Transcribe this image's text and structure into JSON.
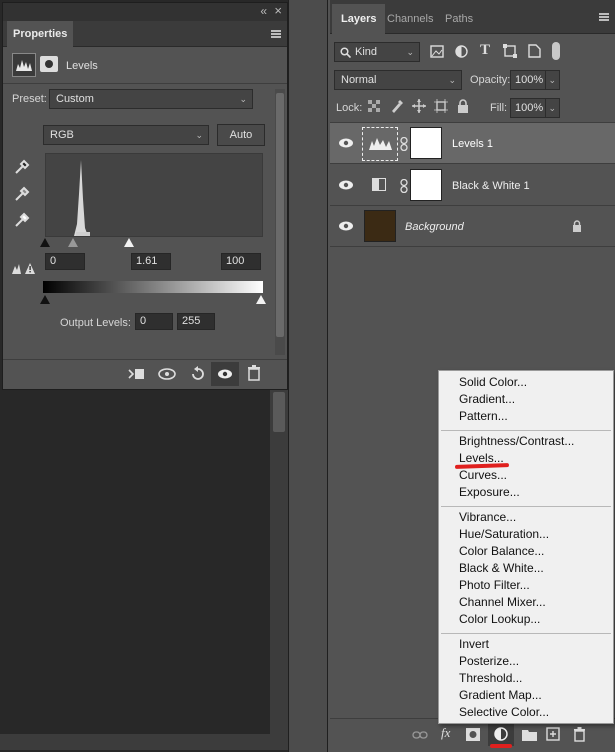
{
  "properties": {
    "title": "Properties",
    "collapse_glyph": "«",
    "close_glyph": "×",
    "adjustment_name": "Levels",
    "preset_label": "Preset:",
    "preset_value": "Custom",
    "channel_value": "RGB",
    "auto_label": "Auto",
    "input_black": "0",
    "input_gamma": "1.61",
    "input_white": "100",
    "output_label": "Output Levels:",
    "output_black": "0",
    "output_white": "255"
  },
  "layers_panel": {
    "tabs": [
      "Layers",
      "Channels",
      "Paths"
    ],
    "filter_kind": "Kind",
    "blend_mode": "Normal",
    "opacity_label": "Opacity:",
    "opacity_value": "100%",
    "lock_label": "Lock:",
    "fill_label": "Fill:",
    "fill_value": "100%",
    "layers": [
      {
        "name": "Levels 1"
      },
      {
        "name": "Black & White 1"
      },
      {
        "name": "Background"
      }
    ],
    "bottom_fx": "fx"
  },
  "adjustment_menu": {
    "group1": [
      "Solid Color...",
      "Gradient...",
      "Pattern..."
    ],
    "group2": [
      "Brightness/Contrast...",
      "Levels...",
      "Curves...",
      "Exposure..."
    ],
    "group3": [
      "Vibrance...",
      "Hue/Saturation...",
      "Color Balance...",
      "Black & White...",
      "Photo Filter...",
      "Channel Mixer...",
      "Color Lookup..."
    ],
    "group4": [
      "Invert",
      "Posterize...",
      "Threshold...",
      "Gradient Map...",
      "Selective Color..."
    ]
  },
  "colors": {
    "panel_bg": "#535353",
    "canvas_bg": "#282828",
    "menu_bg": "#f0f0f0",
    "highlight_underline": "#e0201e",
    "background_thumb": "#3b2a14"
  }
}
